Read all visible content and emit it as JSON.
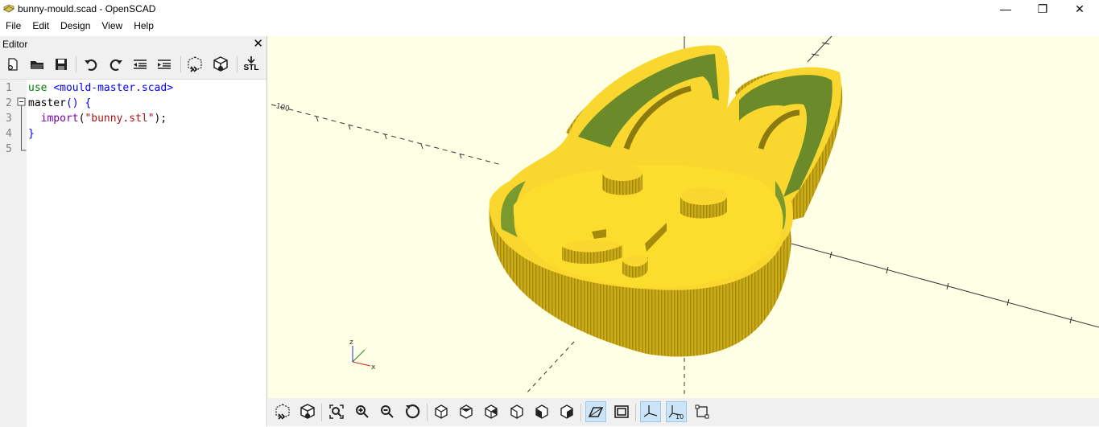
{
  "window": {
    "title": "bunny-mould.scad - OpenSCAD",
    "controls": [
      "—",
      "❐",
      "✕"
    ]
  },
  "menu": [
    "File",
    "Edit",
    "Design",
    "View",
    "Help"
  ],
  "editor": {
    "title": "Editor",
    "close": "✕",
    "lines": [
      {
        "num": "1",
        "parts": [
          {
            "t": "use ",
            "c": "kw-green"
          },
          {
            "t": "<mould-master.scad>",
            "c": "kw-blue"
          }
        ]
      },
      {
        "num": "2",
        "parts": [
          {
            "t": "master",
            "c": ""
          },
          {
            "t": "() {",
            "c": "kw-blue"
          }
        ]
      },
      {
        "num": "3",
        "parts": [
          {
            "t": "  import",
            "c": "kw-purple"
          },
          {
            "t": "(",
            "c": ""
          },
          {
            "t": "\"bunny.stl\"",
            "c": "str"
          },
          {
            "t": ");",
            "c": ""
          }
        ]
      },
      {
        "num": "4",
        "parts": [
          {
            "t": "}",
            "c": "kw-blue"
          }
        ]
      },
      {
        "num": "5",
        "parts": []
      }
    ],
    "toolbar_stl_label": "STL"
  },
  "viewport": {
    "axis_labels": {
      "x": "x",
      "y": "y",
      "z": "z"
    },
    "scale_label": "10",
    "colors": {
      "background": "#ffffe5",
      "model": "#f9d72f",
      "model_shade": "#c9a800",
      "model_inner": "#7a9a30"
    }
  }
}
